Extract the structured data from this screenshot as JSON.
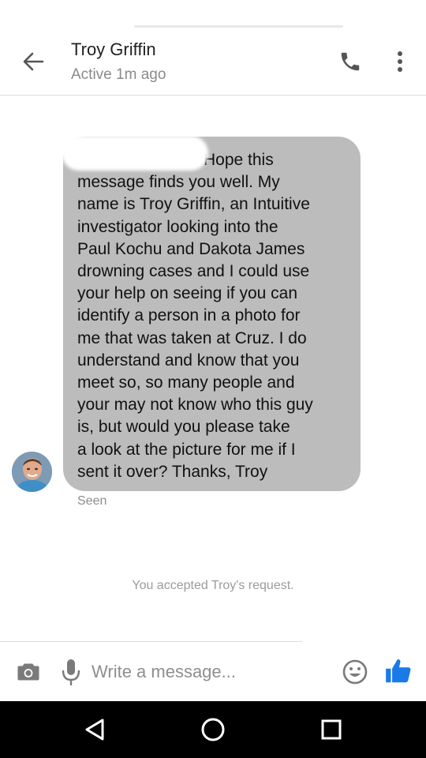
{
  "header": {
    "contact_name": "Troy Griffin",
    "status": "Active 1m ago",
    "back_icon": "arrow-left-icon",
    "call_icon": "phone-icon",
    "more_icon": "more-vert-icon"
  },
  "conversation": {
    "message_text": "Hope this\nmessage finds you well. My\nname is Troy Griffin, an Intuitive\ninvestigator looking into the\nPaul Kochu and Dakota James\ndrowning cases and I could use\nyour help on seeing if you can\nidentify a person in a photo for\nme that was taken at Cruz. I do\nunderstand and know that you\nmeet so, so many people and\nyour may not know who this guy\nis, but would you please take\na look at the picture for me if I\nsent it over?  Thanks, Troy",
    "receipt": "Seen",
    "system_notice": "You accepted Troy's request."
  },
  "composer": {
    "placeholder": "Write a message...",
    "camera_icon": "camera-icon",
    "mic_icon": "mic-icon",
    "emoji_icon": "emoji-icon",
    "like_icon": "thumbs-up-icon",
    "like_color": "#1a7ae8"
  },
  "navbar": {
    "back_icon": "nav-back-icon",
    "home_icon": "nav-home-icon",
    "recent_icon": "nav-recents-icon"
  }
}
